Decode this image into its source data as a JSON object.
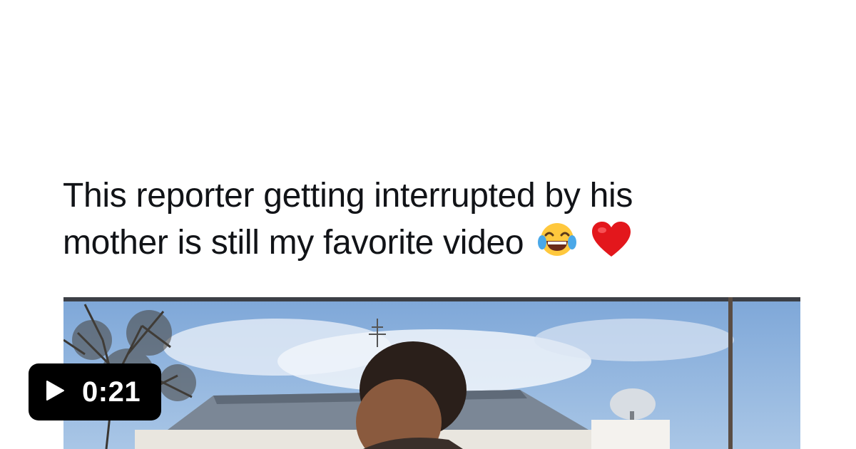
{
  "tweet": {
    "line1": "This reporter getting interrupted by his",
    "line2": "mother is still my favorite video",
    "emojis": [
      "tears-of-joy-emoji",
      "red-heart-emoji"
    ]
  },
  "video": {
    "duration": "0:21",
    "play_icon": "play-icon"
  },
  "colors": {
    "text": "#111317",
    "badge_bg": "#000000",
    "badge_text": "#ffffff",
    "sky": "#8fb3dd"
  }
}
